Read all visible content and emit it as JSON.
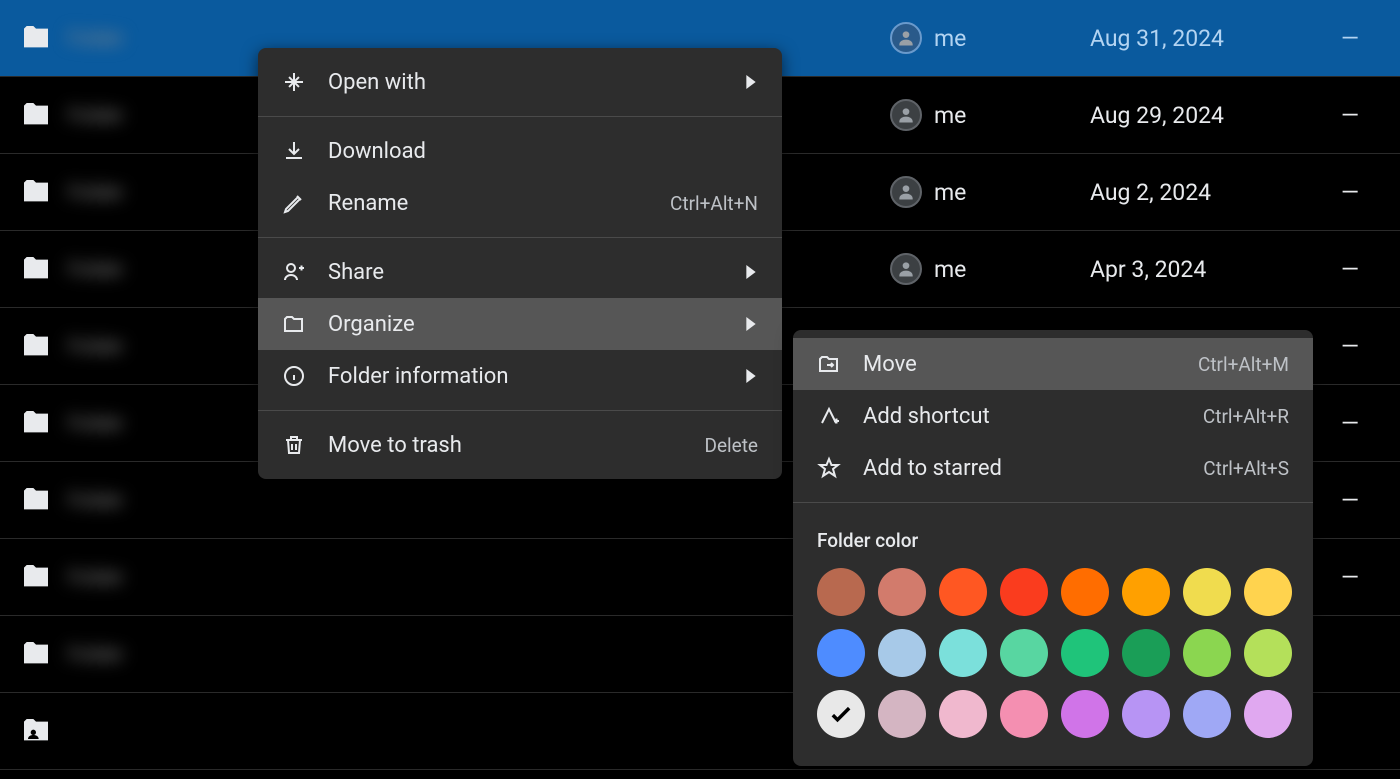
{
  "rows": [
    {
      "name": "Folder",
      "owner": "me",
      "date": "Aug 31, 2024",
      "size": "—",
      "selected": true
    },
    {
      "name": "Folder",
      "owner": "me",
      "date": "Aug 29, 2024",
      "size": "—"
    },
    {
      "name": "Folder",
      "owner": "me",
      "date": "Aug 2, 2024",
      "size": "—"
    },
    {
      "name": "Folder",
      "owner": "me",
      "date": "Apr 3, 2024",
      "size": "—"
    },
    {
      "name": "Folder",
      "owner": "",
      "date": "",
      "size": "—"
    },
    {
      "name": "Folder",
      "owner": "",
      "date": "",
      "size": "—"
    },
    {
      "name": "Folder",
      "owner": "",
      "date": "",
      "size": "—"
    },
    {
      "name": "Folder",
      "owner": "",
      "date": "",
      "size": "—"
    },
    {
      "name": "Folder",
      "owner": "",
      "date": "",
      "size": ""
    },
    {
      "name": "",
      "owner": "",
      "date": "",
      "size": "",
      "shared": true
    }
  ],
  "menu": {
    "open_with": "Open with",
    "download": "Download",
    "rename": "Rename",
    "rename_shortcut": "Ctrl+Alt+N",
    "share": "Share",
    "organize": "Organize",
    "folder_info": "Folder information",
    "trash": "Move to trash",
    "trash_shortcut": "Delete"
  },
  "submenu": {
    "move": "Move",
    "move_shortcut": "Ctrl+Alt+M",
    "add_shortcut": "Add shortcut",
    "add_shortcut_key": "Ctrl+Alt+R",
    "add_starred": "Add to starred",
    "add_starred_key": "Ctrl+Alt+S",
    "color_title": "Folder color",
    "colors": [
      "#b8694f",
      "#d27b6c",
      "#ff5722",
      "#fa3c1e",
      "#ff6d00",
      "#ffa000",
      "#f0dc4e",
      "#ffd34e",
      "#4e8cff",
      "#a7c9e8",
      "#7be0db",
      "#58d6a1",
      "#1fc47a",
      "#1a9e57",
      "#8bd650",
      "#b4e05a",
      "#e8e8e8",
      "#d4b5c2",
      "#f0b8ce",
      "#f48fb1",
      "#d074e8",
      "#b794f4",
      "#9fa8f5",
      "#e0a8f0"
    ],
    "selected_color_index": 16
  }
}
